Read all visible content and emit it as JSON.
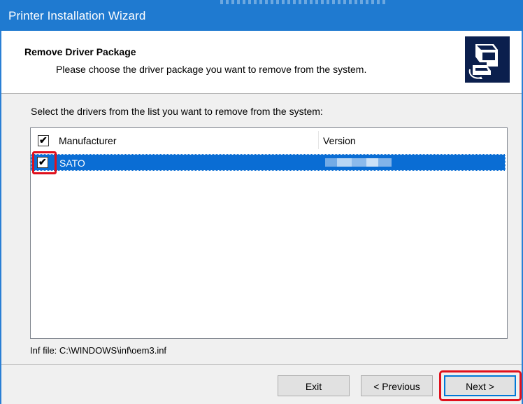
{
  "window": {
    "title": "Printer Installation Wizard"
  },
  "header": {
    "heading": "Remove Driver Package",
    "subheading": "Please choose the driver package you want to remove from the system.",
    "logo_icon": "printer-driver-icon"
  },
  "main": {
    "instruction": "Select the drivers from the list you want to remove from the system:",
    "list": {
      "columns": [
        "Manufacturer",
        "Version"
      ],
      "header_checked": true,
      "rows": [
        {
          "manufacturer": "SATO",
          "version": "",
          "checked": true,
          "selected": true
        }
      ]
    },
    "inf_file": "Inf file: C:\\WINDOWS\\inf\\oem3.inf"
  },
  "buttons": {
    "exit": "Exit",
    "previous": "< Previous",
    "next": "Next >"
  },
  "colors": {
    "titlebar": "#1f7ad0",
    "selection": "#0a6dd4",
    "highlight": "#e0101c"
  }
}
